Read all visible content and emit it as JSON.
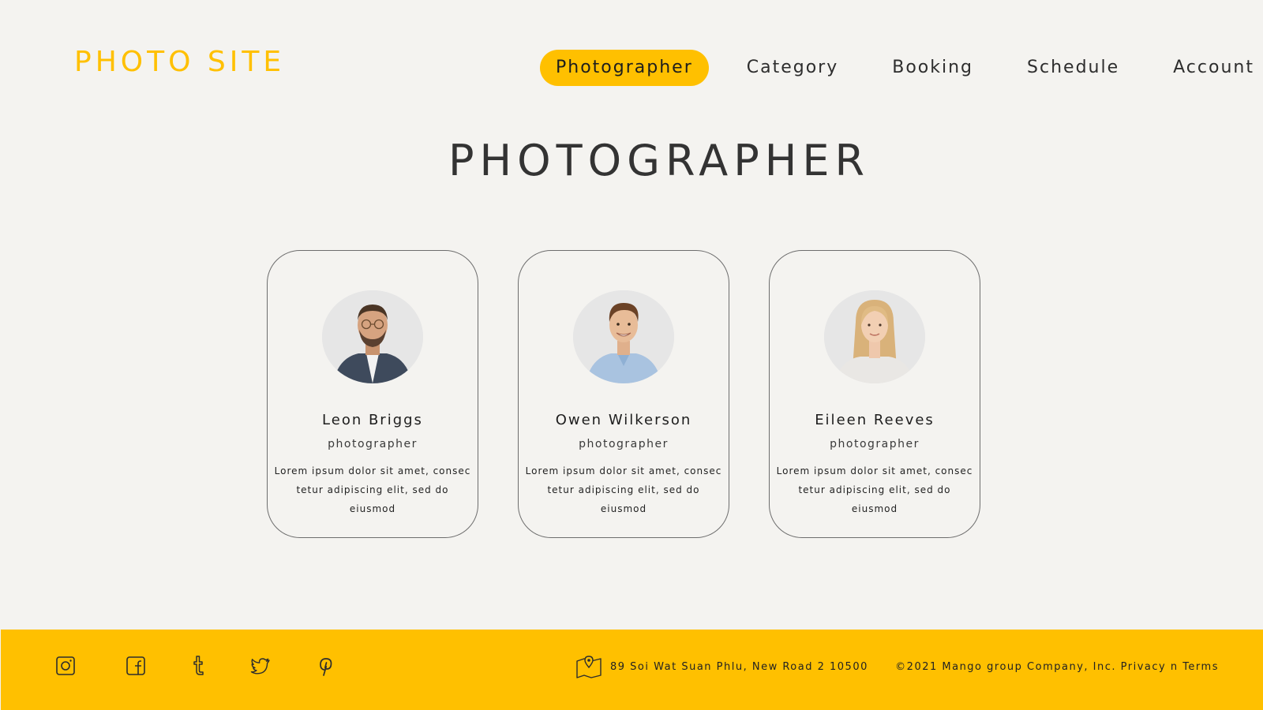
{
  "brand": {
    "logo_text": "PHOTO SITE",
    "accent_color": "#ffc000"
  },
  "nav": {
    "items": [
      {
        "label": "Photographer",
        "active": true
      },
      {
        "label": "Category",
        "active": false
      },
      {
        "label": "Booking",
        "active": false
      },
      {
        "label": "Schedule",
        "active": false
      },
      {
        "label": "Account",
        "active": false
      }
    ]
  },
  "page": {
    "title": "PHOTOGRAPHER"
  },
  "cards": [
    {
      "name": "Leon Briggs",
      "role": "photographer",
      "desc_line1": "Lorem ipsum dolor sit amet, consec",
      "desc_line2": "tetur adipiscing elit, sed do eiusmod",
      "avatar": "man-with-glasses-portrait"
    },
    {
      "name": "Owen Wilkerson",
      "role": "photographer",
      "desc_line1": "Lorem ipsum dolor sit amet, consec",
      "desc_line2": "tetur adipiscing elit, sed do eiusmod",
      "avatar": "smiling-young-man-portrait"
    },
    {
      "name": "Eileen Reeves",
      "role": "photographer",
      "desc_line1": "Lorem ipsum dolor sit amet, consec",
      "desc_line2": "tetur adipiscing elit, sed do eiusmod",
      "avatar": "blonde-woman-portrait"
    }
  ],
  "footer": {
    "social_icons": [
      "instagram-icon",
      "facebook-icon",
      "tumblr-icon",
      "twitter-icon",
      "pinterest-icon"
    ],
    "address_icon": "map-pin-icon",
    "address": "89 Soi Wat Suan Phlu, New Road 2 10500",
    "copyright": "©2021 Mango group Company, Inc. Privacy n Terms",
    "background_color": "#ffc000"
  }
}
